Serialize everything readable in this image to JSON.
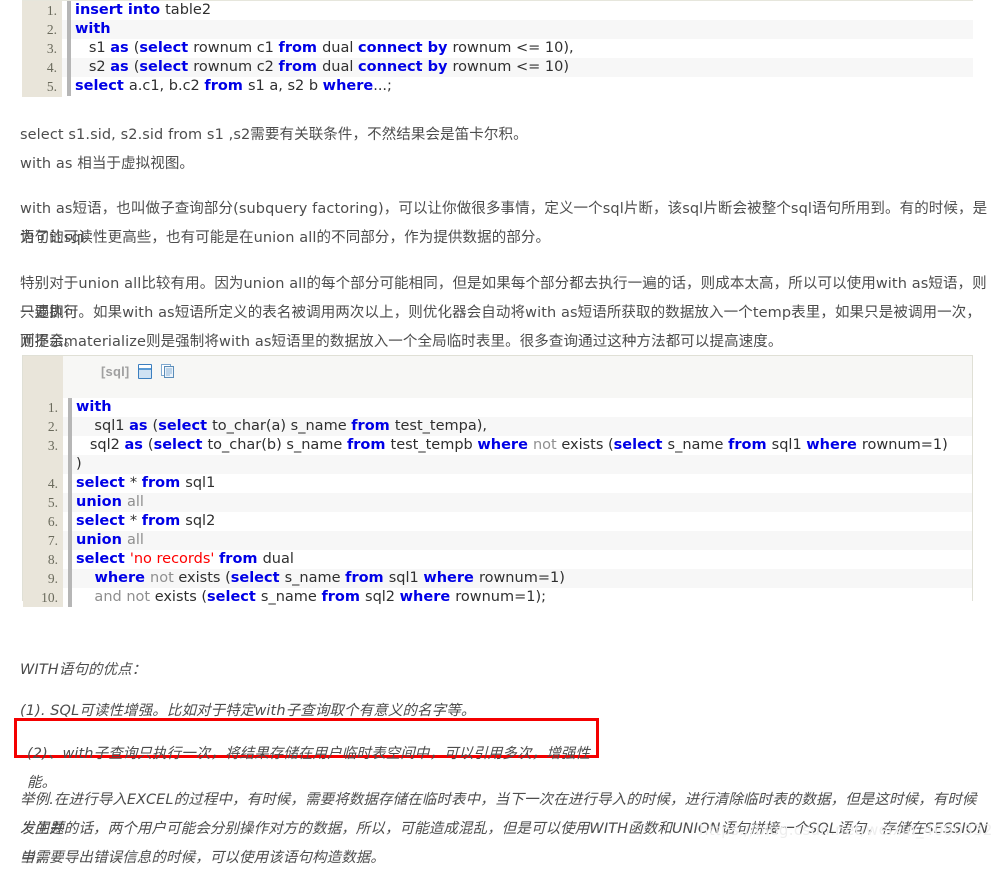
{
  "code_block_1": {
    "language": "sql",
    "lines": [
      {
        "num": "1.",
        "tokens": [
          {
            "t": "kw",
            "v": "insert into "
          },
          {
            "t": "plain",
            "v": "table2"
          }
        ]
      },
      {
        "num": "2.",
        "tokens": [
          {
            "t": "kw",
            "v": "with"
          }
        ]
      },
      {
        "num": "3.",
        "tokens": [
          {
            "t": "plain",
            "v": "   s1 "
          },
          {
            "t": "kw",
            "v": "as "
          },
          {
            "t": "plain",
            "v": "("
          },
          {
            "t": "kw",
            "v": "select "
          },
          {
            "t": "plain",
            "v": "rownum c1 "
          },
          {
            "t": "kw",
            "v": "from "
          },
          {
            "t": "plain",
            "v": "dual "
          },
          {
            "t": "kw",
            "v": "connect by "
          },
          {
            "t": "plain",
            "v": "rownum <= 10),"
          }
        ]
      },
      {
        "num": "4.",
        "tokens": [
          {
            "t": "plain",
            "v": "   s2 "
          },
          {
            "t": "kw",
            "v": "as "
          },
          {
            "t": "plain",
            "v": "("
          },
          {
            "t": "kw",
            "v": "select "
          },
          {
            "t": "plain",
            "v": "rownum c2 "
          },
          {
            "t": "kw",
            "v": "from "
          },
          {
            "t": "plain",
            "v": "dual "
          },
          {
            "t": "kw",
            "v": "connect by "
          },
          {
            "t": "plain",
            "v": "rownum <= 10)"
          }
        ]
      },
      {
        "num": "5.",
        "tokens": [
          {
            "t": "kw",
            "v": "select "
          },
          {
            "t": "plain",
            "v": "a.c1, b.c2 "
          },
          {
            "t": "kw",
            "v": "from "
          },
          {
            "t": "plain",
            "v": "s1 a, s2 b "
          },
          {
            "t": "kw",
            "v": "where"
          },
          {
            "t": "plain",
            "v": "...;"
          }
        ]
      }
    ]
  },
  "p1": "select s1.sid, s2.sid from s1 ,s2需要有关联条件，不然结果会是笛卡尔积。",
  "p2": "with as 相当于虚拟视图。",
  "p3_line1": "with as短语，也叫做子查询部分(subquery factoring)，可以让你做很多事情，定义一个sql片断，该sql片断会被整个sql语句所用到。有的时候，是为了让sql",
  "p3_line2": "语句的可读性更高些，也有可能是在union all的不同部分，作为提供数据的部分。",
  "p4_line1": "特别对于union all比较有用。因为union all的每个部分可能相同，但是如果每个部分都去执行一遍的话，则成本太高，所以可以使用with as短语，则只要执行",
  "p4_line2": "一遍即可。如果with as短语所定义的表名被调用两次以上，则优化器会自动将with as短语所获取的数据放入一个temp表里，如果只是被调用一次，则不会。",
  "p4_line3": "而提示materialize则是强制将with as短语里的数据放入一个全局临时表里。很多查询通过这种方法都可以提高速度。",
  "code_block_2": {
    "language_tag": "[sql]",
    "view_icon": "view-icon",
    "copy_icon": "copy-icon",
    "lines": [
      {
        "num": "1.",
        "tokens": [
          {
            "t": "kw",
            "v": "with"
          }
        ]
      },
      {
        "num": "2.",
        "tokens": [
          {
            "t": "plain",
            "v": "    sql1 "
          },
          {
            "t": "kw",
            "v": "as "
          },
          {
            "t": "plain",
            "v": "("
          },
          {
            "t": "kw",
            "v": "select "
          },
          {
            "t": "plain",
            "v": "to_char(a) s_name "
          },
          {
            "t": "kw",
            "v": "from "
          },
          {
            "t": "plain",
            "v": "test_tempa),"
          }
        ]
      },
      {
        "num": "3.",
        "tokens": [
          {
            "t": "plain",
            "v": "   sql2 "
          },
          {
            "t": "kw",
            "v": "as "
          },
          {
            "t": "plain",
            "v": "("
          },
          {
            "t": "kw",
            "v": "select "
          },
          {
            "t": "plain",
            "v": "to_char(b) s_name "
          },
          {
            "t": "kw",
            "v": "from "
          },
          {
            "t": "plain",
            "v": "test_tempb "
          },
          {
            "t": "kw",
            "v": "where "
          },
          {
            "t": "dim",
            "v": "not "
          },
          {
            "t": "plain",
            "v": "exists ("
          },
          {
            "t": "kw",
            "v": "select "
          },
          {
            "t": "plain",
            "v": "s_name "
          },
          {
            "t": "kw",
            "v": "from "
          },
          {
            "t": "plain",
            "v": "sql1 "
          },
          {
            "t": "kw",
            "v": "where "
          },
          {
            "t": "plain",
            "v": "rownum=1)"
          }
        ]
      },
      {
        "num": "",
        "tokens": [
          {
            "t": "plain",
            "v": ")"
          }
        ]
      },
      {
        "num": "4.",
        "tokens": [
          {
            "t": "kw",
            "v": "select "
          },
          {
            "t": "plain",
            "v": "* "
          },
          {
            "t": "kw",
            "v": "from "
          },
          {
            "t": "plain",
            "v": "sql1"
          }
        ]
      },
      {
        "num": "5.",
        "tokens": [
          {
            "t": "kw",
            "v": "union "
          },
          {
            "t": "dim",
            "v": "all"
          }
        ]
      },
      {
        "num": "6.",
        "tokens": [
          {
            "t": "kw",
            "v": "select "
          },
          {
            "t": "plain",
            "v": "* "
          },
          {
            "t": "kw",
            "v": "from "
          },
          {
            "t": "plain",
            "v": "sql2"
          }
        ]
      },
      {
        "num": "7.",
        "tokens": [
          {
            "t": "kw",
            "v": "union "
          },
          {
            "t": "dim",
            "v": "all"
          }
        ]
      },
      {
        "num": "8.",
        "tokens": [
          {
            "t": "kw",
            "v": "select "
          },
          {
            "t": "str",
            "v": "'no records' "
          },
          {
            "t": "kw",
            "v": "from "
          },
          {
            "t": "plain",
            "v": "dual"
          }
        ]
      },
      {
        "num": "9.",
        "tokens": [
          {
            "t": "plain",
            "v": "    "
          },
          {
            "t": "kw",
            "v": "where "
          },
          {
            "t": "dim",
            "v": "not "
          },
          {
            "t": "plain",
            "v": "exists ("
          },
          {
            "t": "kw",
            "v": "select "
          },
          {
            "t": "plain",
            "v": "s_name "
          },
          {
            "t": "kw",
            "v": "from "
          },
          {
            "t": "plain",
            "v": "sql1 "
          },
          {
            "t": "kw",
            "v": "where "
          },
          {
            "t": "plain",
            "v": "rownum=1)"
          }
        ]
      },
      {
        "num": "10.",
        "tokens": [
          {
            "t": "dim",
            "v": "    and not "
          },
          {
            "t": "plain",
            "v": "exists ("
          },
          {
            "t": "kw",
            "v": "select "
          },
          {
            "t": "plain",
            "v": "s_name "
          },
          {
            "t": "kw",
            "v": "from "
          },
          {
            "t": "plain",
            "v": "sql2 "
          },
          {
            "t": "kw",
            "v": "where "
          },
          {
            "t": "plain",
            "v": "rownum=1);"
          }
        ]
      }
    ]
  },
  "p5": "WITH语句的优点：",
  "p6": "(1). SQL可读性增强。比如对于特定with子查询取个有意义的名字等。",
  "p7_highlighted": "(2)、with子查询只执行一次，将结果存储在用户临时表空间中，可以引用多次，增强性能。",
  "p8_line1": "举例.在进行导入EXCEL的过程中，有时候，需要将数据存储在临时表中，当下一次在进行导入的时候，进行清除临时表的数据，但是这时候，有时候发生并",
  "p8_line2": "发问题的话，两个用户可能会分别操作对方的数据，所以，可能造成混乱，但是可以使用WITH函数和UNION语句拼接一个SQL语句，存储在SESSION中，",
  "p8_line3": "当需要导出错误信息的时候，可以使用该语句构造数据。",
  "watermark": "https://blog.csdn.net/weixin_40803329",
  "colors": {
    "keyword": "#0000e6",
    "string": "#ff0000",
    "gutter_bg": "#e9e5da",
    "highlight_border": "#f40000",
    "text": "#4d4d4d"
  }
}
